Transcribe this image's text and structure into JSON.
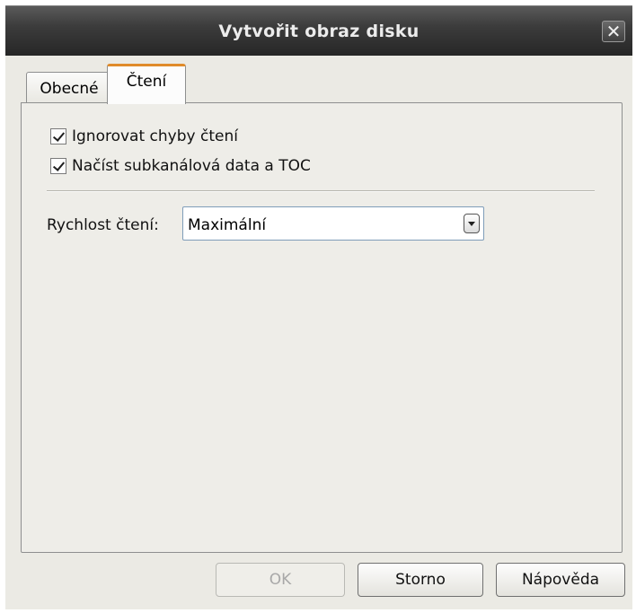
{
  "window": {
    "title": "Vytvořit obraz disku",
    "close_glyph": "✕"
  },
  "tabs": [
    {
      "label": "Obecné",
      "active": false
    },
    {
      "label": "Čtení",
      "active": true
    }
  ],
  "reading": {
    "checkboxes": [
      {
        "label": "Ignorovat chyby čtení",
        "checked": true
      },
      {
        "label": "Načíst subkanálová data a TOC",
        "checked": true
      }
    ],
    "speed_label": "Rychlost čtení:",
    "speed_value": "Maximální"
  },
  "buttons": {
    "ok": "OK",
    "cancel": "Storno",
    "help": "Nápověda"
  },
  "colors": {
    "titlebar": "#2e2e2e",
    "active_tab_accent": "#e08b2a",
    "panel_bg": "#eeede8"
  }
}
